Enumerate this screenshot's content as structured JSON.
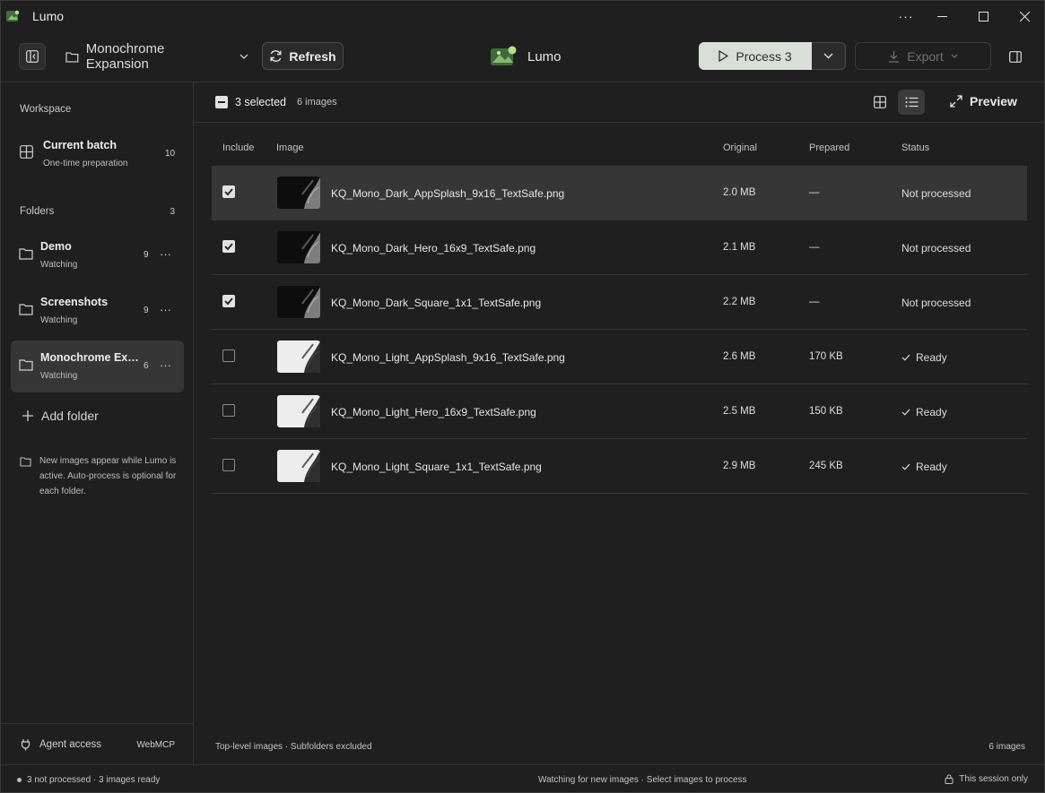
{
  "window": {
    "title": "Lumo"
  },
  "toolbar": {
    "folder_name": "Monochrome Expansion",
    "refresh_label": "Refresh",
    "brand_name": "Lumo",
    "process_label": "Process 3",
    "export_label": "Export"
  },
  "sidebar": {
    "workspace_label": "Workspace",
    "current_batch": {
      "name": "Current batch",
      "sub": "One-time preparation",
      "count": "10"
    },
    "folders_label": "Folders",
    "folders_count": "3",
    "folders": [
      {
        "name": "Demo",
        "status": "Watching",
        "count": "9"
      },
      {
        "name": "Screenshots",
        "status": "Watching",
        "count": "9"
      },
      {
        "name": "Monochrome Exp...",
        "status": "Watching",
        "count": "6"
      }
    ],
    "add_folder_label": "Add folder",
    "hint": "New images appear while Lumo is active. Auto-process is optional for each folder.",
    "agent_label": "Agent access",
    "agent_value": "WebMCP"
  },
  "main": {
    "selected_label": "3 selected",
    "images_label": "6 images",
    "preview_label": "Preview",
    "columns": {
      "include": "Include",
      "image": "Image",
      "original": "Original",
      "prepared": "Prepared",
      "status": "Status"
    },
    "rows": [
      {
        "checked": true,
        "theme": "dark",
        "file": "KQ_Mono_Dark_AppSplash_9x16_TextSafe.png",
        "original": "2.0 MB",
        "prepared": "—",
        "status": "Not processed",
        "ready": false
      },
      {
        "checked": true,
        "theme": "dark",
        "file": "KQ_Mono_Dark_Hero_16x9_TextSafe.png",
        "original": "2.1 MB",
        "prepared": "—",
        "status": "Not processed",
        "ready": false
      },
      {
        "checked": true,
        "theme": "dark",
        "file": "KQ_Mono_Dark_Square_1x1_TextSafe.png",
        "original": "2.2 MB",
        "prepared": "—",
        "status": "Not processed",
        "ready": false
      },
      {
        "checked": false,
        "theme": "light",
        "file": "KQ_Mono_Light_AppSplash_9x16_TextSafe.png",
        "original": "2.6 MB",
        "prepared": "170 KB",
        "status": "Ready",
        "ready": true
      },
      {
        "checked": false,
        "theme": "light",
        "file": "KQ_Mono_Light_Hero_16x9_TextSafe.png",
        "original": "2.5 MB",
        "prepared": "150 KB",
        "status": "Ready",
        "ready": true
      },
      {
        "checked": false,
        "theme": "light",
        "file": "KQ_Mono_Light_Square_1x1_TextSafe.png",
        "original": "2.9 MB",
        "prepared": "245 KB",
        "status": "Ready",
        "ready": true
      }
    ],
    "footer_left": "Top-level images · Subfolders excluded",
    "footer_right": "6 images"
  },
  "statusbar": {
    "left": "3 not processed · 3 images ready",
    "center": "Watching for new images · Select images to process",
    "right": "This session only"
  },
  "colors": {
    "background": "#1f1f1f",
    "accent_button": "#d9dfd8",
    "brand_green": "#6aa84f"
  }
}
